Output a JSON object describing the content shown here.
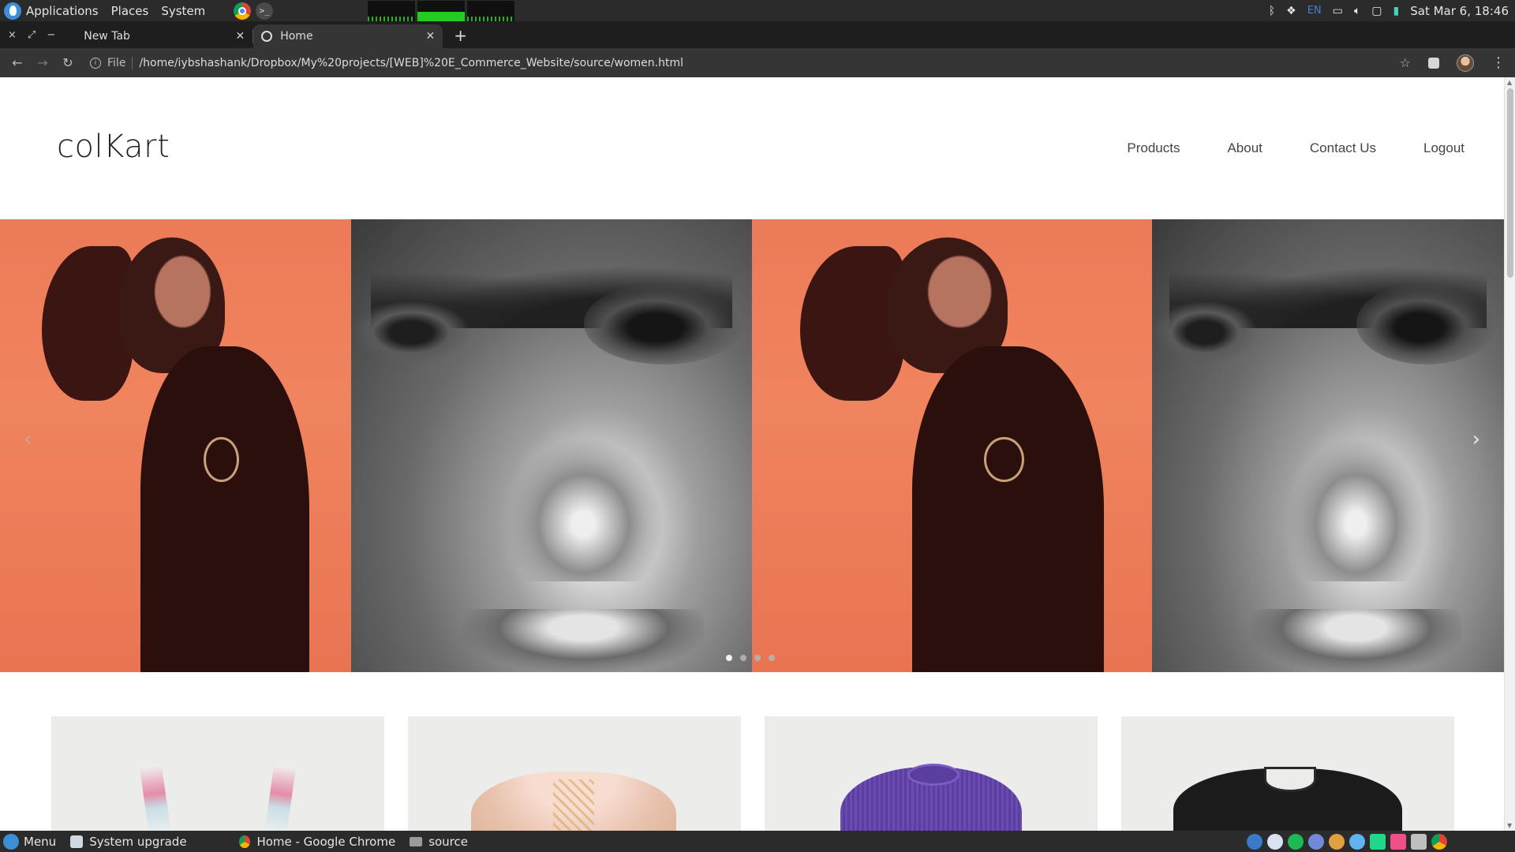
{
  "desktop": {
    "top_menu": [
      "Applications",
      "Places",
      "System"
    ],
    "keyboard_layout": "EN",
    "clock": "Sat Mar  6, 18:46"
  },
  "browser": {
    "window_controls": [
      "×",
      "⤢",
      "−"
    ],
    "tabs": [
      {
        "title": "New Tab",
        "active": false
      },
      {
        "title": "Home",
        "active": true
      }
    ],
    "new_tab_symbol": "+",
    "omnibox": {
      "scheme_label": "File",
      "url": "/home/iybshashank/Dropbox/My%20projects/[WEB]%20E_Commerce_Website/source/women.html"
    }
  },
  "site": {
    "brand": "colKart",
    "nav": [
      "Products",
      "About",
      "Contact Us",
      "Logout"
    ],
    "carousel": {
      "prev_symbol": "‹",
      "next_symbol": "›",
      "slide_count": 4,
      "active_index": 0
    },
    "products": [
      {
        "name": "product-card-1",
        "colors": [
          "#ececea",
          "#e58ca8"
        ]
      },
      {
        "name": "product-card-2",
        "colors": [
          "#ececea",
          "#e8c2ad"
        ]
      },
      {
        "name": "product-card-3",
        "colors": [
          "#ececea",
          "#6a4bb1"
        ]
      },
      {
        "name": "product-card-4",
        "colors": [
          "#ececea",
          "#1b1b1b"
        ]
      }
    ]
  },
  "taskbar": {
    "menu_label": "Menu",
    "tasks": [
      "System upgrade",
      "Home - Google Chrome",
      "source"
    ]
  },
  "colors": {
    "panel_bg": "#2b2b2b",
    "toolbar_bg": "#353535",
    "accent_orange": "#ec7b58"
  }
}
